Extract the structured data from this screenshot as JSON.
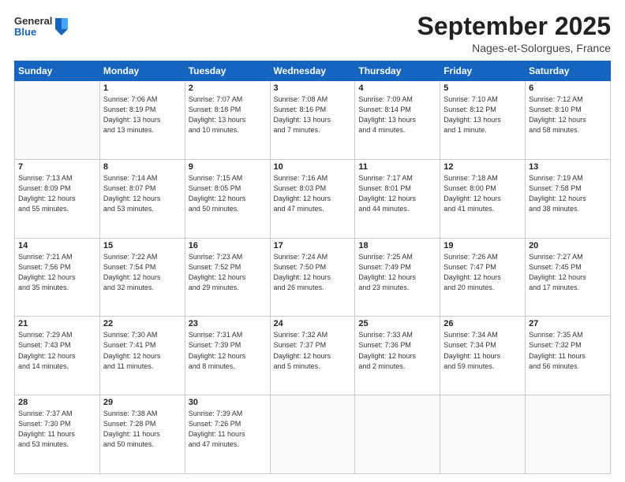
{
  "logo": {
    "general": "General",
    "blue": "Blue"
  },
  "title": "September 2025",
  "location": "Nages-et-Solorgues, France",
  "days_of_week": [
    "Sunday",
    "Monday",
    "Tuesday",
    "Wednesday",
    "Thursday",
    "Friday",
    "Saturday"
  ],
  "weeks": [
    [
      {
        "day": "",
        "info": ""
      },
      {
        "day": "1",
        "info": "Sunrise: 7:06 AM\nSunset: 8:19 PM\nDaylight: 13 hours\nand 13 minutes."
      },
      {
        "day": "2",
        "info": "Sunrise: 7:07 AM\nSunset: 8:18 PM\nDaylight: 13 hours\nand 10 minutes."
      },
      {
        "day": "3",
        "info": "Sunrise: 7:08 AM\nSunset: 8:16 PM\nDaylight: 13 hours\nand 7 minutes."
      },
      {
        "day": "4",
        "info": "Sunrise: 7:09 AM\nSunset: 8:14 PM\nDaylight: 13 hours\nand 4 minutes."
      },
      {
        "day": "5",
        "info": "Sunrise: 7:10 AM\nSunset: 8:12 PM\nDaylight: 13 hours\nand 1 minute."
      },
      {
        "day": "6",
        "info": "Sunrise: 7:12 AM\nSunset: 8:10 PM\nDaylight: 12 hours\nand 58 minutes."
      }
    ],
    [
      {
        "day": "7",
        "info": "Sunrise: 7:13 AM\nSunset: 8:09 PM\nDaylight: 12 hours\nand 55 minutes."
      },
      {
        "day": "8",
        "info": "Sunrise: 7:14 AM\nSunset: 8:07 PM\nDaylight: 12 hours\nand 53 minutes."
      },
      {
        "day": "9",
        "info": "Sunrise: 7:15 AM\nSunset: 8:05 PM\nDaylight: 12 hours\nand 50 minutes."
      },
      {
        "day": "10",
        "info": "Sunrise: 7:16 AM\nSunset: 8:03 PM\nDaylight: 12 hours\nand 47 minutes."
      },
      {
        "day": "11",
        "info": "Sunrise: 7:17 AM\nSunset: 8:01 PM\nDaylight: 12 hours\nand 44 minutes."
      },
      {
        "day": "12",
        "info": "Sunrise: 7:18 AM\nSunset: 8:00 PM\nDaylight: 12 hours\nand 41 minutes."
      },
      {
        "day": "13",
        "info": "Sunrise: 7:19 AM\nSunset: 7:58 PM\nDaylight: 12 hours\nand 38 minutes."
      }
    ],
    [
      {
        "day": "14",
        "info": "Sunrise: 7:21 AM\nSunset: 7:56 PM\nDaylight: 12 hours\nand 35 minutes."
      },
      {
        "day": "15",
        "info": "Sunrise: 7:22 AM\nSunset: 7:54 PM\nDaylight: 12 hours\nand 32 minutes."
      },
      {
        "day": "16",
        "info": "Sunrise: 7:23 AM\nSunset: 7:52 PM\nDaylight: 12 hours\nand 29 minutes."
      },
      {
        "day": "17",
        "info": "Sunrise: 7:24 AM\nSunset: 7:50 PM\nDaylight: 12 hours\nand 26 minutes."
      },
      {
        "day": "18",
        "info": "Sunrise: 7:25 AM\nSunset: 7:49 PM\nDaylight: 12 hours\nand 23 minutes."
      },
      {
        "day": "19",
        "info": "Sunrise: 7:26 AM\nSunset: 7:47 PM\nDaylight: 12 hours\nand 20 minutes."
      },
      {
        "day": "20",
        "info": "Sunrise: 7:27 AM\nSunset: 7:45 PM\nDaylight: 12 hours\nand 17 minutes."
      }
    ],
    [
      {
        "day": "21",
        "info": "Sunrise: 7:29 AM\nSunset: 7:43 PM\nDaylight: 12 hours\nand 14 minutes."
      },
      {
        "day": "22",
        "info": "Sunrise: 7:30 AM\nSunset: 7:41 PM\nDaylight: 12 hours\nand 11 minutes."
      },
      {
        "day": "23",
        "info": "Sunrise: 7:31 AM\nSunset: 7:39 PM\nDaylight: 12 hours\nand 8 minutes."
      },
      {
        "day": "24",
        "info": "Sunrise: 7:32 AM\nSunset: 7:37 PM\nDaylight: 12 hours\nand 5 minutes."
      },
      {
        "day": "25",
        "info": "Sunrise: 7:33 AM\nSunset: 7:36 PM\nDaylight: 12 hours\nand 2 minutes."
      },
      {
        "day": "26",
        "info": "Sunrise: 7:34 AM\nSunset: 7:34 PM\nDaylight: 11 hours\nand 59 minutes."
      },
      {
        "day": "27",
        "info": "Sunrise: 7:35 AM\nSunset: 7:32 PM\nDaylight: 11 hours\nand 56 minutes."
      }
    ],
    [
      {
        "day": "28",
        "info": "Sunrise: 7:37 AM\nSunset: 7:30 PM\nDaylight: 11 hours\nand 53 minutes."
      },
      {
        "day": "29",
        "info": "Sunrise: 7:38 AM\nSunset: 7:28 PM\nDaylight: 11 hours\nand 50 minutes."
      },
      {
        "day": "30",
        "info": "Sunrise: 7:39 AM\nSunset: 7:26 PM\nDaylight: 11 hours\nand 47 minutes."
      },
      {
        "day": "",
        "info": ""
      },
      {
        "day": "",
        "info": ""
      },
      {
        "day": "",
        "info": ""
      },
      {
        "day": "",
        "info": ""
      }
    ]
  ]
}
